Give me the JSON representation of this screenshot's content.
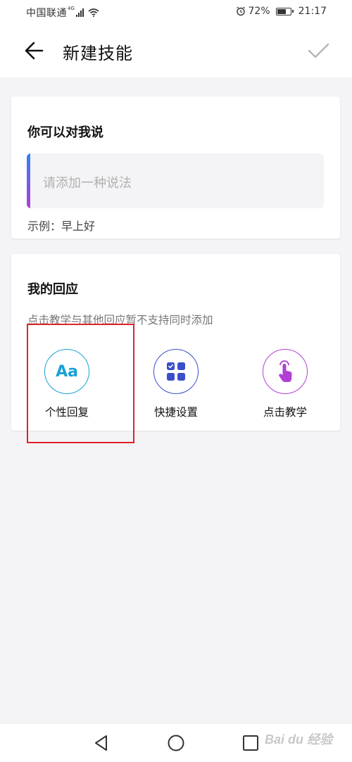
{
  "status_bar": {
    "carrier": "中国联通",
    "network_type": "4G",
    "battery_percent": "72%",
    "battery_level": 0.72,
    "time": "21:17",
    "icons": [
      "signal-icon",
      "wifi-icon",
      "alarm-icon",
      "battery-icon"
    ]
  },
  "header": {
    "title": "新建技能",
    "back_icon": "arrow-left-icon",
    "confirm_icon": "checkmark-icon"
  },
  "say_section": {
    "title": "你可以对我说",
    "input_placeholder": "请添加一种说法",
    "example": "示例：早上好"
  },
  "response_section": {
    "title": "我的回应",
    "note": "点击教学与其他回应暂不支持同时添加",
    "options": [
      {
        "label": "个性回复",
        "icon": "text-aa-icon",
        "icon_text": "Aa",
        "color": "#1aa0d8"
      },
      {
        "label": "快捷设置",
        "icon": "grid-apps-icon",
        "color": "#3a4fc9"
      },
      {
        "label": "点击教学",
        "icon": "tap-finger-icon",
        "color": "#b23fd6"
      }
    ]
  },
  "annotation": {
    "highlight_color": "#e0222a"
  },
  "nav_bar": {
    "buttons": [
      "nav-back-icon",
      "nav-home-icon",
      "nav-recent-icon"
    ]
  },
  "watermark": {
    "text": "Bai du 经验"
  },
  "colors": {
    "accent_gradient_start": "#2f80ff",
    "accent_gradient_end": "#b23fd6",
    "background": "#f4f4f6"
  }
}
